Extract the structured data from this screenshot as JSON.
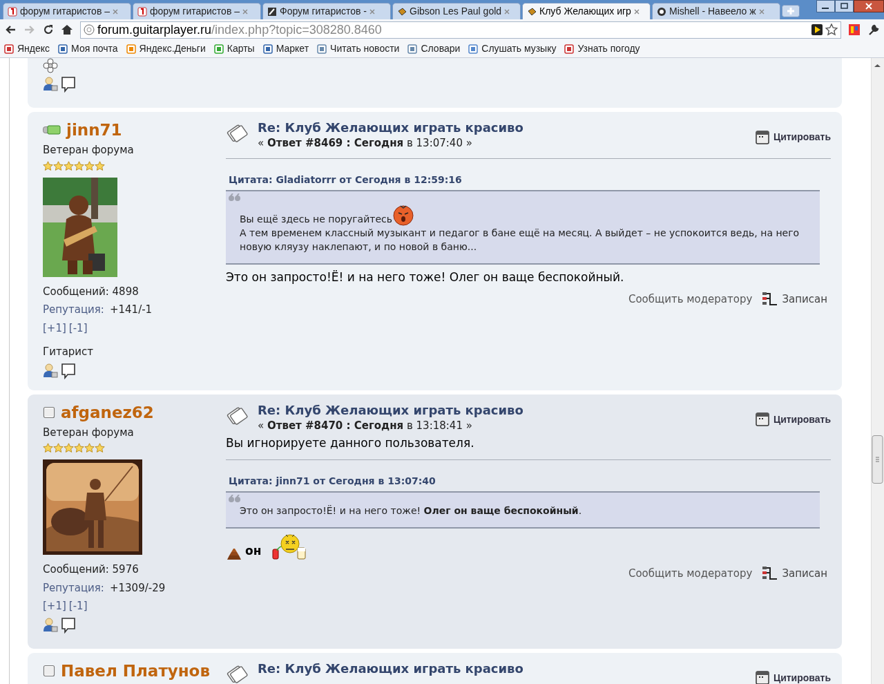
{
  "browser": {
    "tabs": [
      {
        "title": "форум гитаристов –",
        "selected": false,
        "kind": "yandex"
      },
      {
        "title": "форум гитаристов –",
        "selected": false,
        "kind": "yandex"
      },
      {
        "title": "Форум гитаристов -",
        "selected": false,
        "kind": "guitar"
      },
      {
        "title": "Gibson Les Paul gold",
        "selected": false,
        "kind": "pick"
      },
      {
        "title": "Клуб Желающих игр",
        "selected": true,
        "kind": "pick"
      },
      {
        "title": "Mishell - Навеело ж",
        "selected": false,
        "kind": "circle"
      }
    ],
    "address": {
      "host": "forum.guitarplayer.ru",
      "path": "/index.php?topic=308280.8460"
    },
    "bookmarks": [
      "Яндекс",
      "Моя почта",
      "Яндекс.Деньги",
      "Карты",
      "Маркет",
      "Читать новости",
      "Словари",
      "Слушать музыку",
      "Узнать погоду"
    ]
  },
  "posts": [
    {
      "author": "jinn71",
      "online": true,
      "rank": "Ветеран форума",
      "stars": 6,
      "avatar": {
        "kind": "picture"
      },
      "posts_count": "Сообщений: 4898",
      "rep_label": "Репутация:",
      "rep_value": "+141/-1",
      "rep_buttons": [
        "[+1]",
        "[-1]"
      ],
      "custom_title": "Гитарист",
      "title": "Re: Клуб Желающих играть красиво",
      "meta": "« **Ответ #8469 : Сегодня** в 13:07:40 »",
      "quote_button": "Цитировать",
      "quote": {
        "header": "Цитата: Gladiatorrr от Сегодня в 12:59:16",
        "parts": [
          {
            "kind": "text",
            "text": "Вы ещё здесь не поругайтесь"
          },
          {
            "kind": "angry"
          },
          {
            "kind": "break"
          },
          {
            "kind": "text",
            "text": "А тем временем классный музыкант и педагог в бане ещё на месяц. А выйдет – не успокоится ведь, на него новую кляузу наклепают, и по новой в баню..."
          }
        ]
      },
      "body": [
        {
          "kind": "text",
          "text": "Это он запросто!Ё! и на него тоже! Олег он ваще беспокойный."
        }
      ],
      "report": "Сообщить модератору",
      "logged": "Записан"
    },
    {
      "author": "afganez62",
      "online": false,
      "rank": "Ветеран форума",
      "stars": 6,
      "avatar": {
        "kind": "picture"
      },
      "posts_count": "Сообщений: 5976",
      "rep_label": "Репутация:",
      "rep_value": "+1309/-29",
      "rep_buttons": [
        "[+1]",
        "[-1]"
      ],
      "title": "Re: Клуб Желающих играть красиво",
      "meta": "« **Ответ #8470 : Сегодня** в 13:18:41 »",
      "quote_button": "Цитировать",
      "ignored": "Вы игнорируете данного пользователя.",
      "quote": {
        "header": "Цитата: jinn71 от Сегодня в 13:07:40",
        "parts": [
          {
            "kind": "text",
            "text": "Это он запросто!Ё! и на него тоже! **Олег он ваще беспокойный**."
          }
        ]
      },
      "body": [
        {
          "kind": "poop"
        },
        {
          "kind": "bold",
          "text": "он"
        },
        {
          "kind": "drunk"
        }
      ],
      "report": "Сообщить модератору",
      "logged": "Записан"
    },
    {
      "author": "Павел Платунов",
      "online": false,
      "title": "Re: Клуб Желающих играть красиво",
      "quote_button": "Цитировать"
    }
  ]
}
